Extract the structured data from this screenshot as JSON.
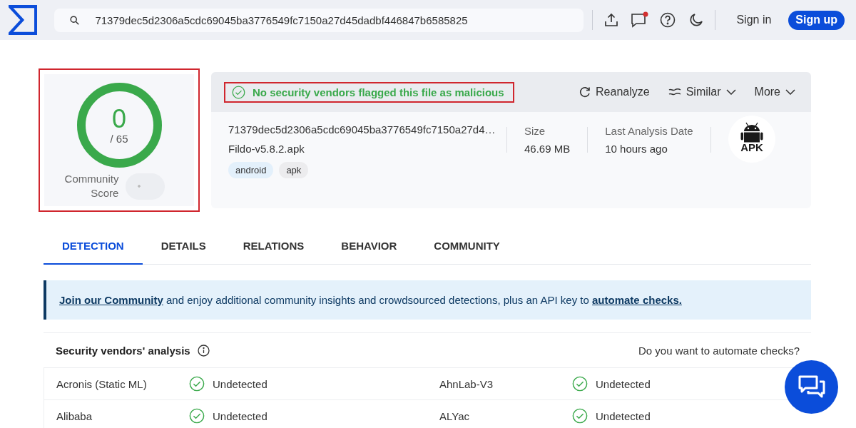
{
  "header": {
    "search": {
      "value": "71379dec5d2306a5cdc69045ba3776549fc7150a27d45dadbf446847b6585825"
    },
    "notifications_unread": true,
    "sign_in": "Sign in",
    "sign_up": "Sign up"
  },
  "score": {
    "detections": "0",
    "total": "/ 65",
    "label_1": "Community",
    "label_2": "Score",
    "highlighted": true,
    "vote_disabled": true
  },
  "summary": {
    "verdict_text": "No security vendors flagged this file as malicious",
    "highlighted": true,
    "actions": [
      {
        "label": "Reanalyze",
        "kind": "reload"
      },
      {
        "label": "Similar",
        "kind": "similar"
      },
      {
        "label": "More",
        "kind": "more"
      }
    ],
    "hash": "71379dec5d2306a5cdc69045ba3776549fc7150a27d4…",
    "filename": "Fildo-v5.8.2.apk",
    "tags": [
      {
        "label": "android",
        "color": "#e3f0fb"
      },
      {
        "label": "apk",
        "color": "#ececee"
      }
    ],
    "size_label": "Size",
    "size": "46.69 MB",
    "date_label": "Last Analysis Date",
    "date": "10 hours ago",
    "file_type": "APK"
  },
  "tabs": [
    {
      "label": "DETECTION",
      "selected": true
    },
    {
      "label": "DETAILS",
      "selected": false
    },
    {
      "label": "RELATIONS",
      "selected": false
    },
    {
      "label": "BEHAVIOR",
      "selected": false
    },
    {
      "label": "COMMUNITY",
      "selected": false
    }
  ],
  "banner": {
    "link_1": "Join our Community",
    "text": " and enjoy additional community insights and crowdsourced detections, plus an API key to ",
    "link_2": "automate checks."
  },
  "vendors": {
    "title": "Security vendors' analysis",
    "automate": "Do you want to automate checks?",
    "rows": [
      [
        {
          "name": "Acronis (Static ML)",
          "result": "Undetected",
          "detected": false
        },
        {
          "name": "AhnLab-V3",
          "result": "Undetected",
          "detected": false
        }
      ],
      [
        {
          "name": "Alibaba",
          "result": "Undetected",
          "detected": false
        },
        {
          "name": "ALYac",
          "result": "Undetected",
          "detected": false
        }
      ]
    ]
  }
}
